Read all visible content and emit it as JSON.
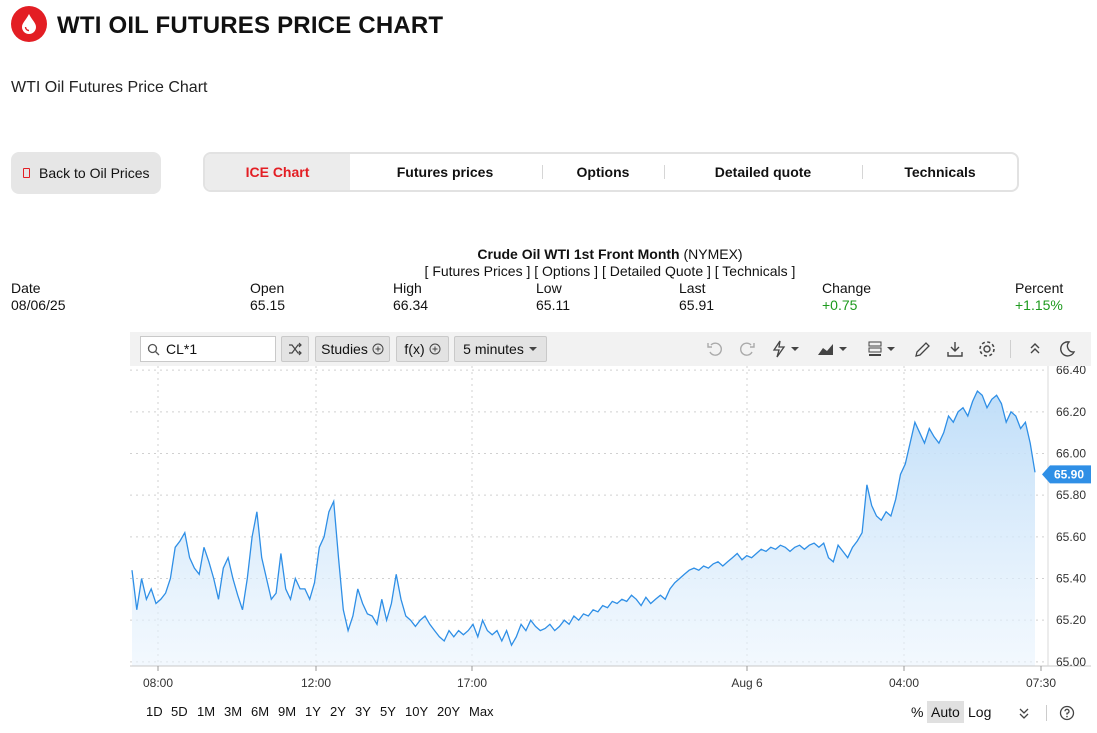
{
  "header": {
    "title": "WTI OIL FUTURES PRICE CHART",
    "subtitle": "WTI Oil Futures Price Chart",
    "brand_color": "#e31e24"
  },
  "nav": {
    "back_label": "Back to Oil Prices",
    "tabs": [
      {
        "label": "ICE Chart",
        "active": true
      },
      {
        "label": "Futures prices",
        "active": false
      },
      {
        "label": "Options",
        "active": false
      },
      {
        "label": "Detailed quote",
        "active": false
      },
      {
        "label": "Technicals",
        "active": false
      }
    ]
  },
  "instrument": {
    "name": "Crude Oil WTI 1st Front Month",
    "exchange": "(NYMEX)",
    "links": "[ Futures Prices ] [ Options ] [ Detailed Quote ] [ Technicals ]"
  },
  "quote": {
    "date_label": "Date",
    "date": "08/06/25",
    "open_label": "Open",
    "open": "65.15",
    "high_label": "High",
    "high": "66.34",
    "low_label": "Low",
    "low": "65.11",
    "last_label": "Last",
    "last": "65.91",
    "change_label": "Change",
    "change": "+0.75",
    "percent_label": "Percent",
    "percent": "+1.15%",
    "up_color": "#1d9a1d"
  },
  "toolbar": {
    "symbol": "CL*1",
    "studies_label": "Studies",
    "fx_label": "f(x)",
    "interval_label": "5 minutes",
    "icons": [
      "search-icon",
      "shuffle-icon",
      "undo-icon",
      "redo-icon",
      "lightning-icon",
      "chart-style-icon",
      "layout-icon",
      "pencil-icon",
      "download-icon",
      "gear-icon",
      "collapse-icon",
      "moon-icon"
    ]
  },
  "ranges": [
    "1D",
    "5D",
    "1M",
    "3M",
    "6M",
    "9M",
    "1Y",
    "2Y",
    "3Y",
    "5Y",
    "10Y",
    "20Y",
    "Max"
  ],
  "bottom_controls": {
    "percent": "%",
    "auto": "Auto",
    "log": "Log"
  },
  "chart_data": {
    "type": "area",
    "line_color": "#2f8fe6",
    "ylim": [
      64.98,
      66.42
    ],
    "y_ticks": [
      "66.40",
      "66.20",
      "66.00",
      "65.80",
      "65.60",
      "65.40",
      "65.20",
      "65.00"
    ],
    "x_ticks": [
      "08:00",
      "12:00",
      "17:00",
      "Aug 6",
      "04:00",
      "07:30"
    ],
    "last_value_label": "65.90",
    "last_value": 65.9,
    "values": [
      65.44,
      65.25,
      65.4,
      65.3,
      65.35,
      65.28,
      65.3,
      65.33,
      65.4,
      65.55,
      65.58,
      65.62,
      65.5,
      65.45,
      65.42,
      65.55,
      65.48,
      65.4,
      65.3,
      65.45,
      65.5,
      65.4,
      65.32,
      65.25,
      65.4,
      65.6,
      65.72,
      65.5,
      65.4,
      65.3,
      65.33,
      65.52,
      65.35,
      65.3,
      65.4,
      65.35,
      65.35,
      65.3,
      65.38,
      65.55,
      65.6,
      65.72,
      65.77,
      65.5,
      65.25,
      65.15,
      65.22,
      65.35,
      65.28,
      65.23,
      65.22,
      65.18,
      65.3,
      65.2,
      65.28,
      65.42,
      65.3,
      65.22,
      65.2,
      65.17,
      65.2,
      65.22,
      65.18,
      65.15,
      65.12,
      65.1,
      65.15,
      65.12,
      65.15,
      65.13,
      65.15,
      65.18,
      65.12,
      65.2,
      65.15,
      65.13,
      65.15,
      65.1,
      65.15,
      65.08,
      65.12,
      65.18,
      65.15,
      65.2,
      65.17,
      65.15,
      65.16,
      65.18,
      65.15,
      65.17,
      65.2,
      65.18,
      65.22,
      65.2,
      65.23,
      65.22,
      65.25,
      65.24,
      65.27,
      65.26,
      65.29,
      65.28,
      65.3,
      65.29,
      65.32,
      65.3,
      65.27,
      65.31,
      65.28,
      65.3,
      65.32,
      65.3,
      65.35,
      65.38,
      65.4,
      65.42,
      65.44,
      65.45,
      65.44,
      65.46,
      65.45,
      65.47,
      65.48,
      65.46,
      65.48,
      65.5,
      65.52,
      65.49,
      65.51,
      65.5,
      65.52,
      65.54,
      65.53,
      65.55,
      65.54,
      65.56,
      65.55,
      65.53,
      65.55,
      65.56,
      65.54,
      65.56,
      65.57,
      65.55,
      65.57,
      65.5,
      65.48,
      65.56,
      65.53,
      65.5,
      65.55,
      65.58,
      65.62,
      65.85,
      65.75,
      65.7,
      65.68,
      65.72,
      65.7,
      65.78,
      65.9,
      65.95,
      66.05,
      66.15,
      66.1,
      66.05,
      66.12,
      66.08,
      66.05,
      66.1,
      66.18,
      66.15,
      66.2,
      66.22,
      66.18,
      66.25,
      66.3,
      66.28,
      66.22,
      66.26,
      66.28,
      66.24,
      66.15,
      66.2,
      66.18,
      66.12,
      66.15,
      66.05,
      65.91
    ]
  }
}
